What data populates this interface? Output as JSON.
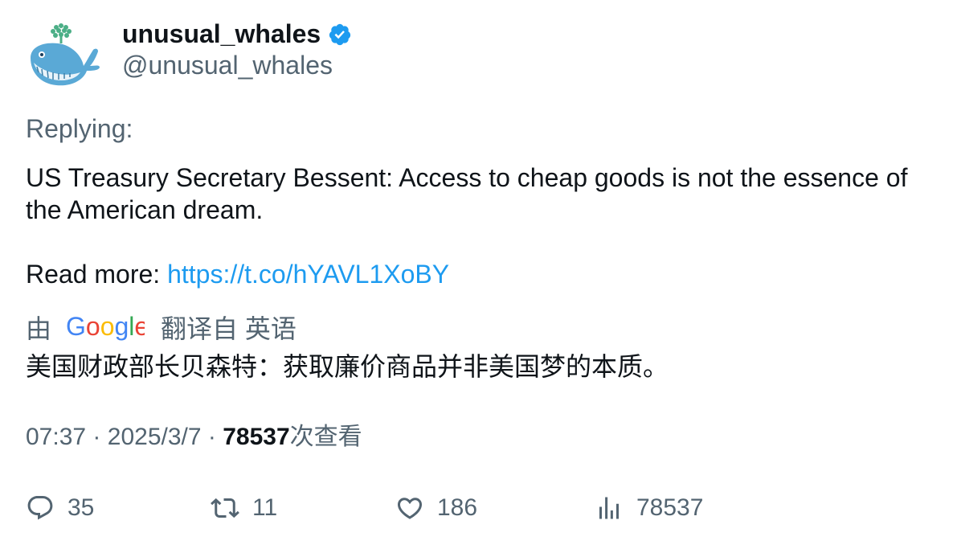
{
  "author": {
    "display_name": "unusual_whales",
    "handle": "@unusual_whales"
  },
  "tweet": {
    "replying_label": "Replying:",
    "text": "US Treasury Secretary Bessent: Access to cheap goods is not the essence of the American dream.",
    "read_more_label": "Read more: ",
    "link": "https://t.co/hYAVL1XoBY"
  },
  "translation": {
    "prefix": "由",
    "provider_logo": "Google",
    "suffix": "翻译自 英语",
    "text": "美国财政部长贝森特：获取廉价商品并非美国梦的本质。"
  },
  "meta": {
    "time": "07:37",
    "date": "2025/3/7",
    "separator": "·",
    "views": "78537",
    "views_label": "次查看"
  },
  "actions": {
    "reply_count": "35",
    "retweet_count": "11",
    "like_count": "186",
    "views_count": "78537"
  },
  "colors": {
    "link": "#1d9bf0",
    "secondary_text": "#536471",
    "verified": "#1d9bf0"
  },
  "icons": [
    "whale-avatar-icon",
    "verified-badge-icon",
    "google-logo",
    "reply-icon",
    "retweet-icon",
    "like-icon",
    "views-icon"
  ]
}
